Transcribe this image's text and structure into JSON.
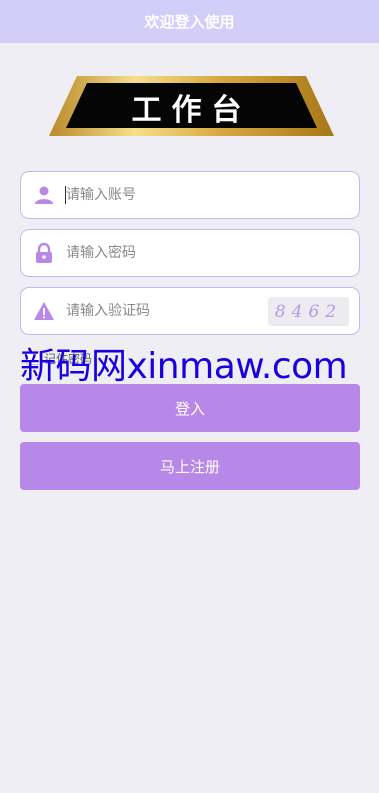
{
  "header": {
    "title": "欢迎登入使用"
  },
  "logo": {
    "text": "工作台"
  },
  "form": {
    "account": {
      "placeholder": "请输入账号",
      "icon": "user-icon"
    },
    "password": {
      "placeholder": "请输入密码",
      "icon": "lock-icon"
    },
    "captcha": {
      "placeholder": "请输入验证码",
      "icon": "warning-icon",
      "code": "8462"
    },
    "remember_label": "记住密码"
  },
  "buttons": {
    "login": "登入",
    "register": "马上注册"
  },
  "watermark": "新码网xinmaw.com",
  "colors": {
    "header_bg": "#d3cdfa",
    "accent": "#b888e8",
    "field_border": "#c8b7ef",
    "page_bg": "#efeef5",
    "watermark": "#1a00e0"
  }
}
